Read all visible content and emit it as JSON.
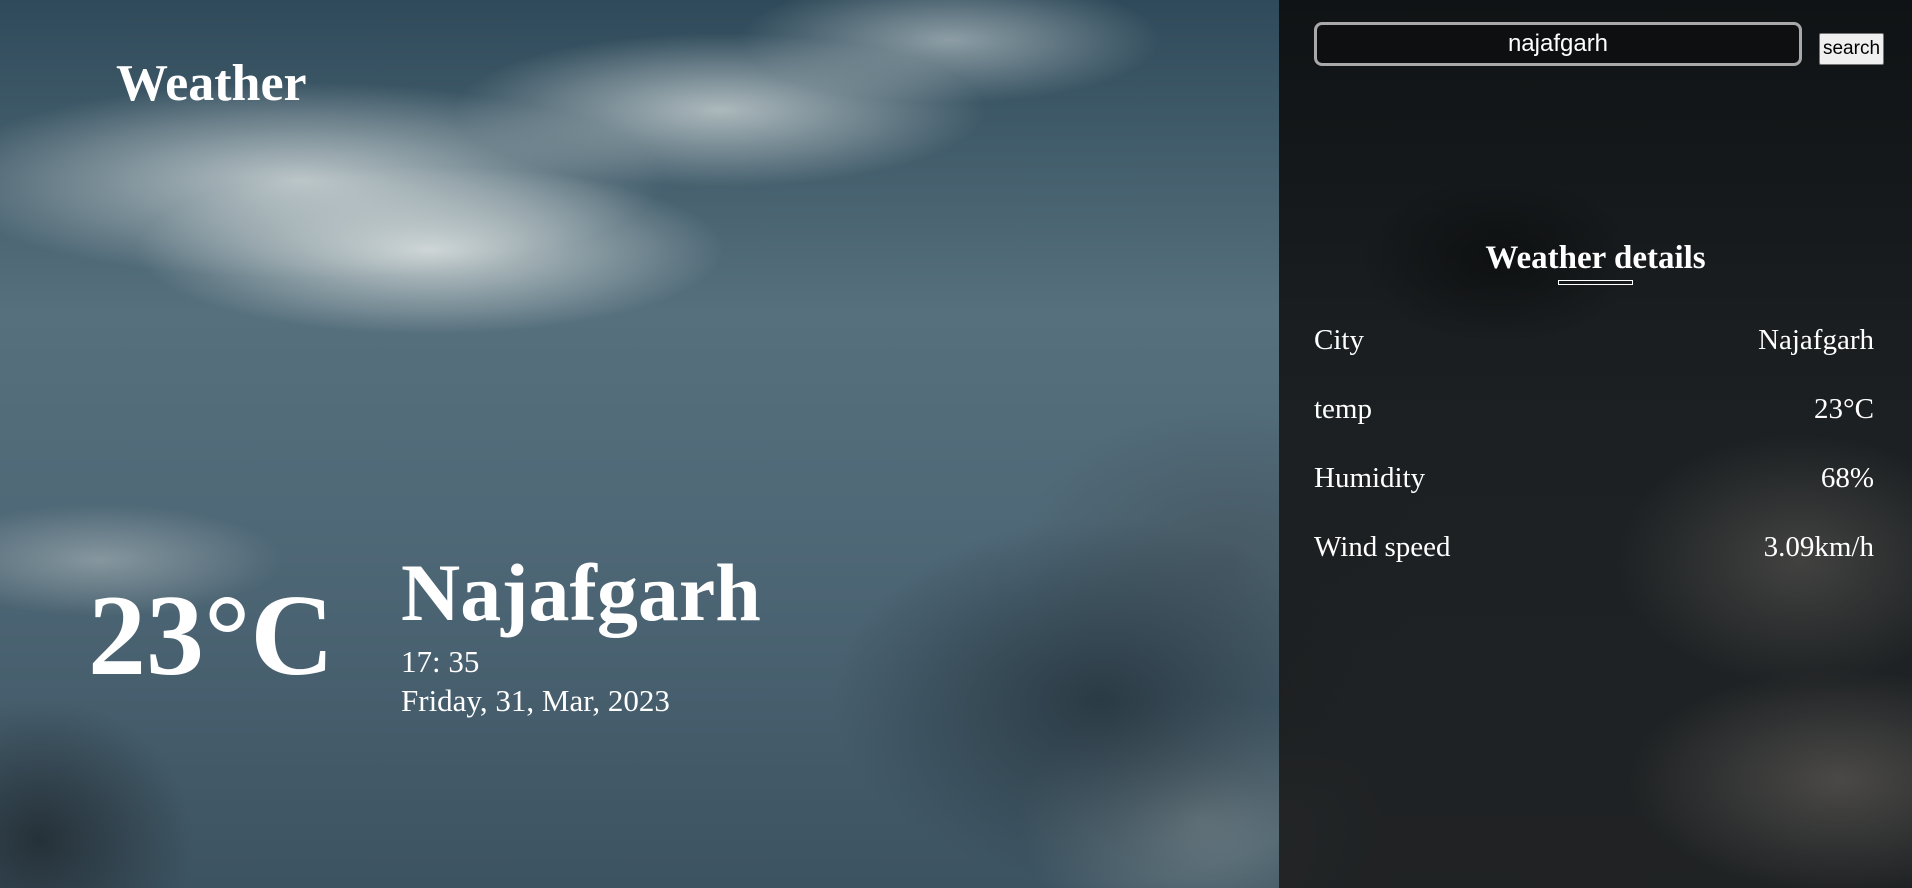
{
  "app": {
    "title": "Weather"
  },
  "current": {
    "temperature": "23°C",
    "city": "Najafgarh",
    "time": "17: 35",
    "date": "Friday, 31, Mar, 2023"
  },
  "search": {
    "value": "najafgarh",
    "button_label": "search"
  },
  "details": {
    "heading": "Weather details",
    "rows": [
      {
        "label": "City",
        "value": "Najafgarh"
      },
      {
        "label": "temp",
        "value": "23°C"
      },
      {
        "label": "Humidity",
        "value": "68%"
      },
      {
        "label": "Wind speed",
        "value": "3.09km/h"
      }
    ]
  }
}
